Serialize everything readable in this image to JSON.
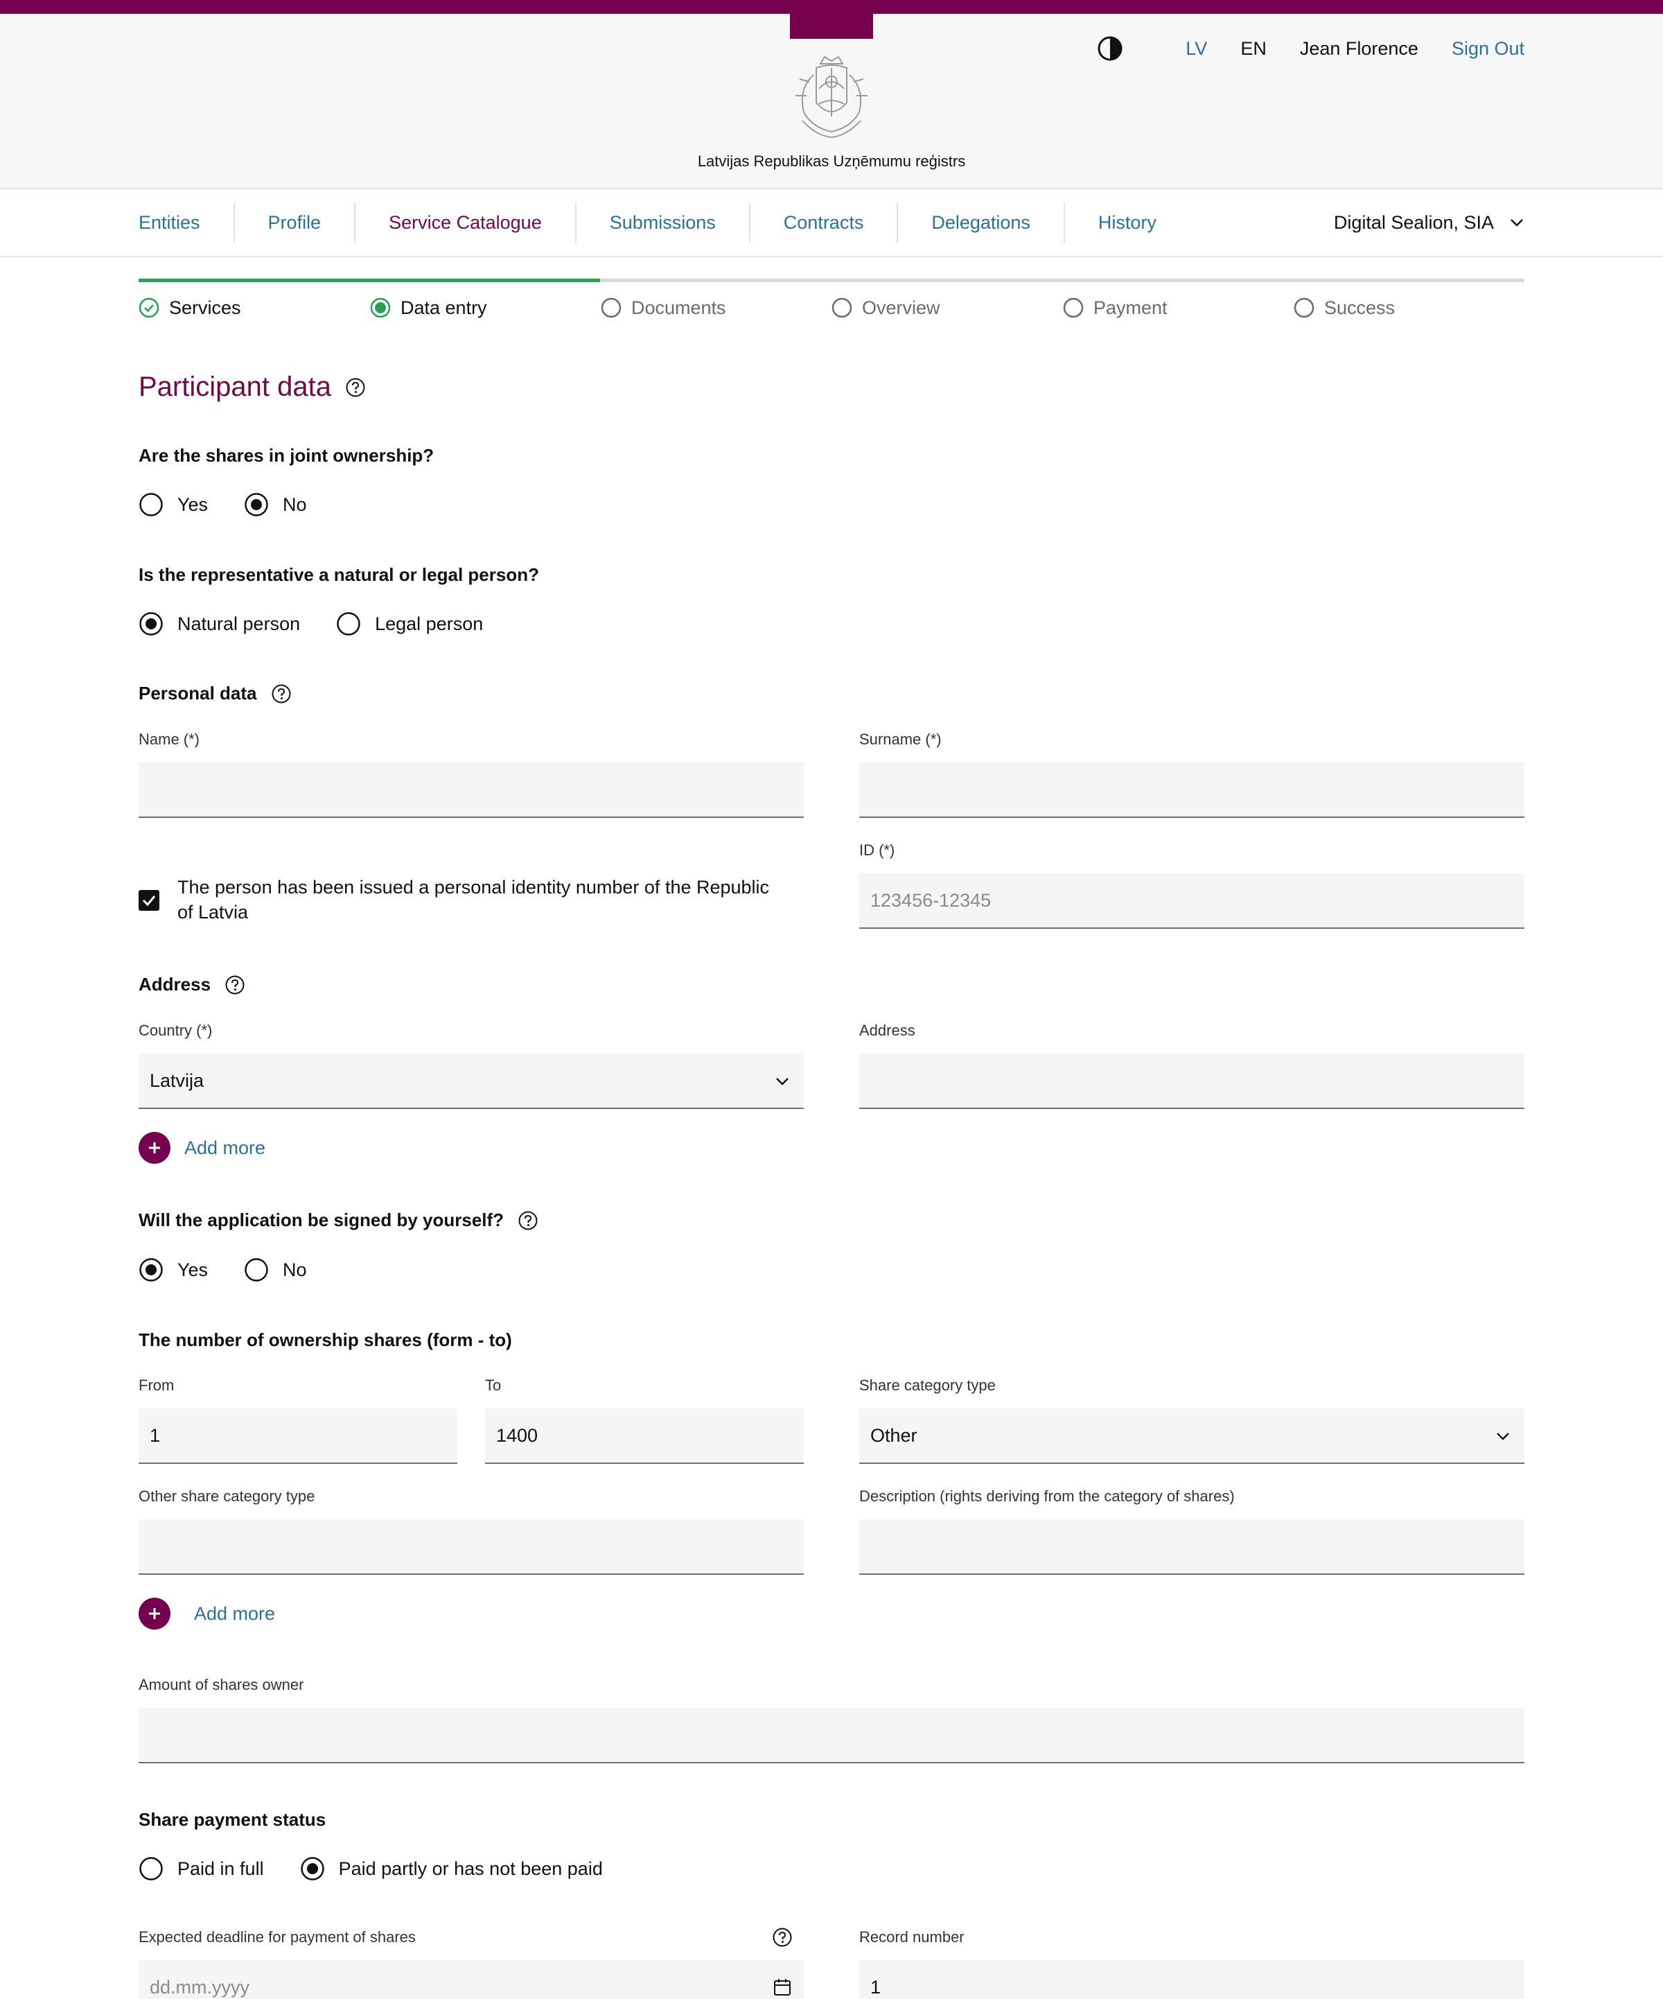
{
  "header": {
    "org_name": "Latvijas Republikas Uzņēmumu reģistrs",
    "lang_lv": "LV",
    "lang_en": "EN",
    "user_name": "Jean Florence",
    "sign_out": "Sign Out"
  },
  "nav": {
    "items": [
      "Entities",
      "Profile",
      "Service Catalogue",
      "Submissions",
      "Contracts",
      "Delegations",
      "History"
    ],
    "active_index": 2,
    "org_selector": "Digital Sealion, SIA"
  },
  "steps": {
    "items": [
      "Services",
      "Data entry",
      "Documents",
      "Overview",
      "Payment",
      "Success"
    ],
    "current_index": 1
  },
  "form": {
    "title": "Participant data",
    "joint_ownership": {
      "question": "Are the shares in joint ownership?",
      "yes": "Yes",
      "no": "No",
      "selected": "No"
    },
    "representative": {
      "question": "Is the representative a natural or legal person?",
      "natural": "Natural person",
      "legal": "Legal person",
      "selected": "Natural person"
    },
    "personal_data": {
      "heading": "Personal data",
      "name_label": "Name (*)",
      "name_value": "",
      "surname_label": "Surname (*)",
      "surname_value": "",
      "id_label": "ID (*)",
      "id_placeholder": "123456-12345",
      "personal_code_checkbox": "The person has been issued a personal identity number of the Republic of Latvia",
      "personal_code_checked": true
    },
    "address": {
      "heading": "Address",
      "country_label": "Country (*)",
      "country_value": "Latvija",
      "address_label": "Address",
      "address_value": "",
      "add_more": "Add more"
    },
    "signed_by_self": {
      "question": "Will the application be signed by yourself?",
      "yes": "Yes",
      "no": "No",
      "selected": "Yes"
    },
    "shares": {
      "heading": "The number of ownership shares (form - to)",
      "from_label": "From",
      "from_value": "1",
      "to_label": "To",
      "to_value": "1400",
      "category_label": "Share category type",
      "category_value": "Other",
      "other_category_label": "Other share category type",
      "other_category_value": "",
      "description_label": "Description (rights deriving from the category of shares)",
      "description_value": "",
      "add_more": "Add more",
      "amount_label": "Amount of shares owner",
      "amount_value": ""
    },
    "payment_status": {
      "heading": "Share payment status",
      "paid_full": "Paid in full",
      "paid_partly": "Paid partly or has not been paid",
      "selected": "Paid partly or has not been paid",
      "deadline_label": "Expected deadline for payment of shares",
      "deadline_placeholder": "dd.mm.yyyy",
      "record_label": "Record number",
      "record_value": "1"
    }
  },
  "colors": {
    "brand": "#75004d",
    "link": "#2e6f96",
    "success": "#2e9d55",
    "field_bg": "#f5f5f5"
  }
}
